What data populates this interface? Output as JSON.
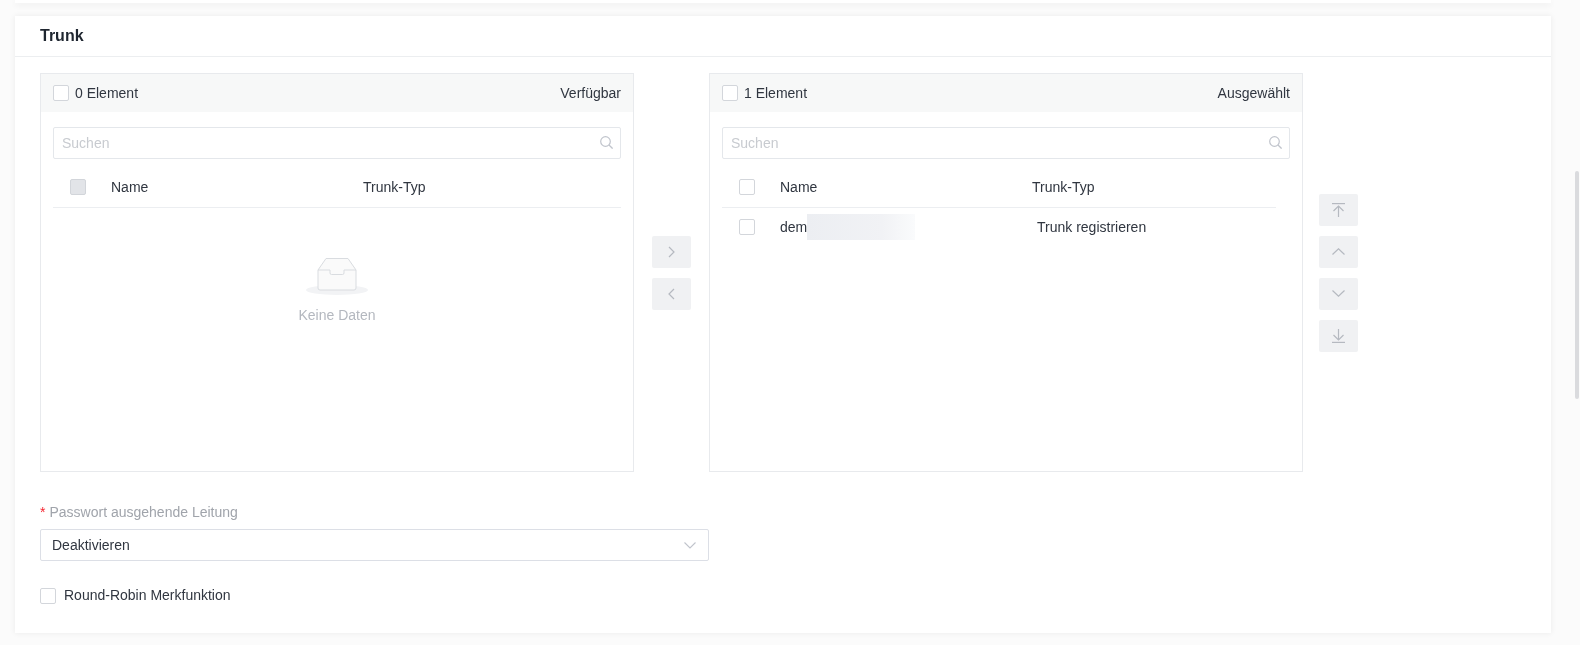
{
  "section": {
    "title": "Trunk"
  },
  "transfer": {
    "panels": [
      {
        "select_all": {
          "checked": false
        },
        "count": "0 Element",
        "title": "Verfügbar",
        "search": {
          "placeholder": "Suchen"
        },
        "header_checkbox": {
          "checked": false,
          "disabled": true
        },
        "columns": [
          "Name",
          "Trunk-Typ"
        ],
        "empty_text": "Keine Daten"
      },
      {
        "select_all": {
          "checked": false
        },
        "count": "1 Element",
        "title": "Ausgewählt",
        "search": {
          "placeholder": "Suchen"
        },
        "header_checkbox": {
          "checked": false,
          "disabled": false
        },
        "columns": [
          "Name",
          "Trunk-Typ"
        ],
        "rows": [
          {
            "checked": false,
            "name": "dem",
            "redacted": true,
            "trunk_type": "Trunk registrieren"
          }
        ]
      }
    ],
    "move_buttons": [
      {
        "kind": "right",
        "disabled": true
      },
      {
        "kind": "left",
        "disabled": true
      }
    ],
    "order_buttons": [
      {
        "kind": "top",
        "disabled": true
      },
      {
        "kind": "up",
        "disabled": true
      },
      {
        "kind": "down",
        "disabled": true
      },
      {
        "kind": "bottom",
        "disabled": true
      }
    ]
  },
  "password_field": {
    "required_mark": "*",
    "label": "Passwort ausgehende Leitung",
    "value": "Deaktivieren"
  },
  "round_robin": {
    "label": "Round-Robin Merkfunktion",
    "checked": false
  }
}
